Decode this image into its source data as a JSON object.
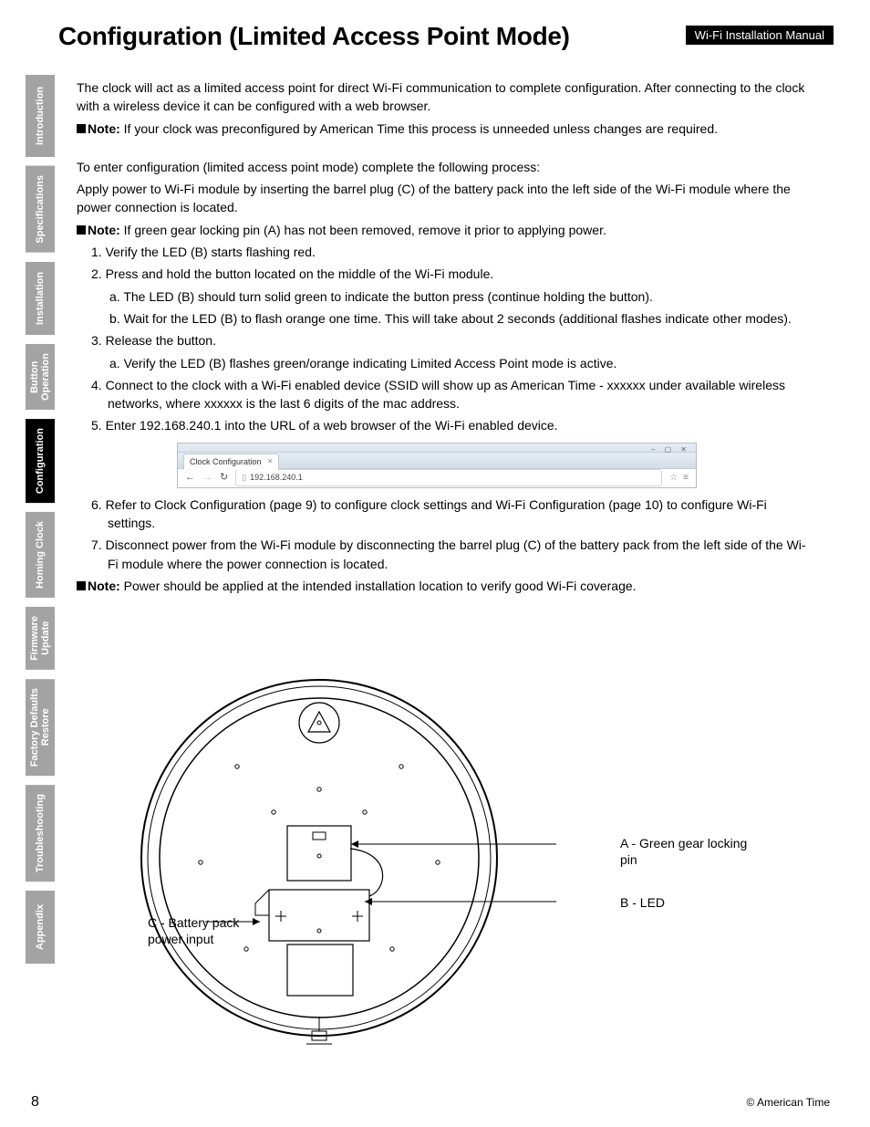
{
  "header": {
    "title": "Configuration (Limited Access Point Mode)",
    "badge": "Wi-Fi Installation Manual"
  },
  "sidebar": [
    {
      "label": "Introduction",
      "active": false
    },
    {
      "label": "Specifications",
      "active": false
    },
    {
      "label": "Installation",
      "active": false
    },
    {
      "label": "Button\nOperation",
      "active": false
    },
    {
      "label": "Configuration",
      "active": true
    },
    {
      "label": "Homing Clock",
      "active": false
    },
    {
      "label": "Firmware\nUpdate",
      "active": false
    },
    {
      "label": "Factory Defaults\nRestore",
      "active": false
    },
    {
      "label": "Troubleshooting",
      "active": false
    },
    {
      "label": "Appendix",
      "active": false
    }
  ],
  "body": {
    "intro": "The clock will act as a limited access point for direct Wi-Fi communication to complete configuration. After connecting to the clock with a wireless device it can be configured with a web browser.",
    "note1_label": "Note:",
    "note1_text": " If your clock was preconfigured by American Time this process is unneeded unless changes are required.",
    "enter_config": "To enter configuration (limited access point mode) complete the following process:",
    "apply_power": "Apply power to Wi-Fi module by inserting the barrel plug (C) of the battery pack into the left side of the Wi-Fi module where the power connection is located.",
    "note2_label": "Note:",
    "note2_text": " If green gear locking pin (A) has not been removed, remove it prior to applying power.",
    "steps": {
      "s1": "1. Verify the LED (B) starts flashing red.",
      "s2": "2. Press and hold the button located on the middle of the Wi-Fi module.",
      "s2a": "a. The LED (B) should turn solid green to indicate the button press (continue holding the button).",
      "s2b": "b. Wait for the LED (B) to flash orange one time.  This will take about 2 seconds (additional flashes indicate other modes).",
      "s3": "3. Release the button.",
      "s3a": "a. Verify the LED (B) flashes green/orange indicating Limited Access Point mode is active.",
      "s4": "4. Connect to the clock with a Wi-Fi enabled device (SSID will show up as American Time - xxxxxx under available wireless networks, where xxxxxx is the last 6 digits of the mac address.",
      "s5": "5. Enter 192.168.240.1 into the URL of a web browser of the Wi-Fi enabled device.",
      "s6": "6. Refer to Clock Configuration (page 9) to configure clock settings and Wi-Fi Configuration (page 10) to configure Wi-Fi settings.",
      "s7": "7. Disconnect power from the Wi-Fi module by disconnecting the barrel plug (C) of the battery pack from the left side of the Wi-Fi module where the power connection is located."
    },
    "note3_label": "Note:",
    "note3_text": " Power should be applied at the intended installation location to verify good Wi-Fi coverage."
  },
  "browser": {
    "tab_title": "Clock Configuration",
    "url": "192.168.240.1"
  },
  "diagram": {
    "callout_a": "A - Green gear locking pin",
    "callout_b": "B - LED",
    "callout_c": "C - Battery pack power input"
  },
  "footer": {
    "page": "8",
    "copyright": "© American Time"
  }
}
